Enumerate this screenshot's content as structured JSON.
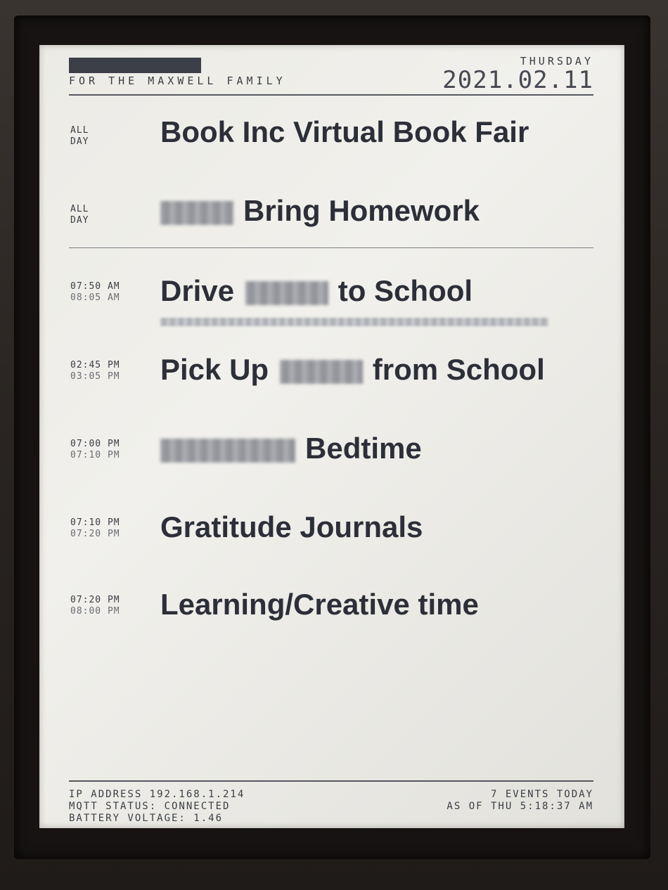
{
  "header": {
    "family": "FOR THE MAXWELL FAMILY",
    "day_name": "THURSDAY",
    "date": "2021.02.11"
  },
  "events": [
    {
      "start": "ALL",
      "end": "DAY",
      "title": "Book Inc Virtual Book Fair",
      "redacted": ""
    },
    {
      "start": "ALL",
      "end": "DAY",
      "title": "Bring Homework",
      "redacted": "before"
    },
    {
      "start": "07:50 AM",
      "end": "08:05 AM",
      "title_a": "Drive",
      "title_b": "to School",
      "redacted": "middle",
      "has_location": true
    },
    {
      "start": "02:45 PM",
      "end": "03:05 PM",
      "title_a": "Pick Up",
      "title_b": "from School",
      "redacted": "middle"
    },
    {
      "start": "07:00 PM",
      "end": "07:10 PM",
      "title": "Bedtime",
      "redacted": "before"
    },
    {
      "start": "07:10 PM",
      "end": "07:20 PM",
      "title": "Gratitude Journals",
      "redacted": ""
    },
    {
      "start": "07:20 PM",
      "end": "08:00 PM",
      "title": "Learning/Creative time",
      "redacted": ""
    }
  ],
  "footer": {
    "ip": "IP ADDRESS 192.168.1.214",
    "mqtt": "MQTT STATUS: CONNECTED",
    "battery": "BATTERY VOLTAGE: 1.46",
    "events_count": "7 EVENTS TODAY",
    "as_of": "AS OF THU 5:18:37 AM"
  },
  "colors": {
    "screen": "#eceae6",
    "ink": "#2c2f38",
    "frame": "#2b2725"
  }
}
